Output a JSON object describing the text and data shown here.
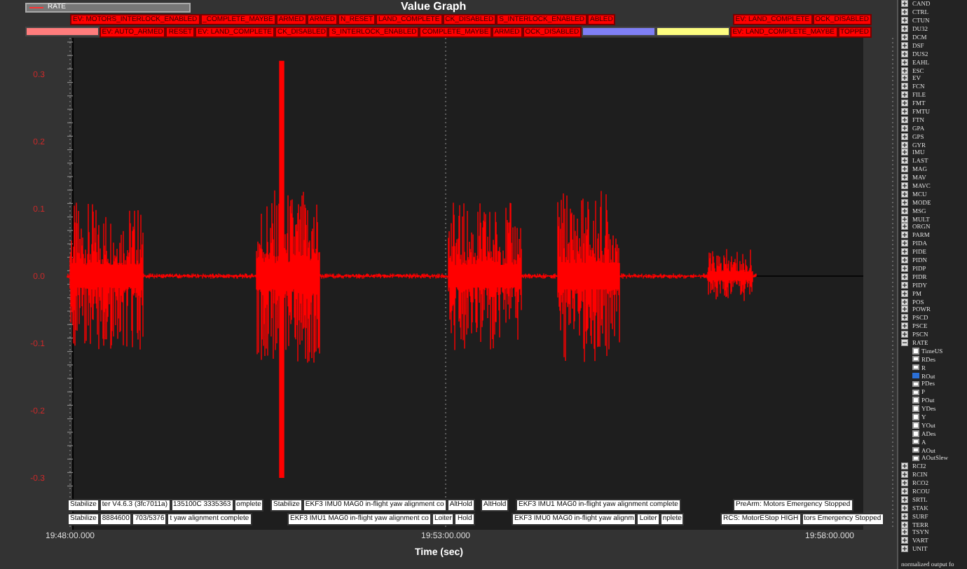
{
  "window": {
    "title": "Value Graph"
  },
  "legend": {
    "label": "RATE"
  },
  "event_rows": [
    {
      "left": [
        {
          "kind": "label",
          "text": "EV: MOTORS_INTERLOCK_ENABLED"
        },
        {
          "kind": "label",
          "text": "_COMPLETE_MAYBE"
        },
        {
          "kind": "label",
          "text": "ARMED"
        },
        {
          "kind": "label",
          "text": "ARMED"
        },
        {
          "kind": "label",
          "text": "N_RESET"
        },
        {
          "kind": "label",
          "text": "LAND_COMPLETE"
        },
        {
          "kind": "label",
          "text": "CK_DISABLED"
        },
        {
          "kind": "label",
          "text": "S_INTERLOCK_ENABLED"
        },
        {
          "kind": "label",
          "text": "ABLED"
        }
      ],
      "right": [
        {
          "kind": "label",
          "text": "EV: LAND_COMPLETE"
        },
        {
          "kind": "label",
          "text": "OCK_DISABLED"
        }
      ]
    },
    {
      "left": [
        {
          "kind": "swatch",
          "color": "#ff7c7c"
        },
        {
          "kind": "label",
          "text": "EV: AUTO_ARMED"
        },
        {
          "kind": "label",
          "text": "RESET"
        },
        {
          "kind": "label",
          "text": "EV: LAND_COMPLETE"
        },
        {
          "kind": "label",
          "text": "CK_DISABLED"
        },
        {
          "kind": "label",
          "text": "S_INTERLOCK_ENABLED"
        },
        {
          "kind": "label",
          "text": "COMPLETE_MAYBE"
        },
        {
          "kind": "label",
          "text": "ARMED"
        },
        {
          "kind": "label",
          "text": "OCK_DISABLED"
        },
        {
          "kind": "swatch",
          "color": "#7f7ff5"
        },
        {
          "kind": "swatch",
          "color": "#fdfd80"
        }
      ],
      "right": [
        {
          "kind": "label",
          "text": "EV: LAND_COMPLETE_MAYBE"
        },
        {
          "kind": "label",
          "text": "TOPPED"
        }
      ]
    }
  ],
  "y_ticks": [
    "0.3",
    "0.2",
    "0.1",
    "0.0",
    "-0.1",
    "-0.2",
    "-0.3"
  ],
  "message_rows": [
    [
      [
        "Stabilize",
        "ter V4.6.3 (3fc7011a)",
        "135100C 3335363",
        "omplete"
      ],
      [
        "Stabilize",
        "EKF3 IMU0 MAG0 in-flight yaw alignment co",
        "AltHold"
      ],
      [
        "AltHold"
      ],
      [
        "EKF3 IMU1 MAG0 in-flight yaw alignment complete"
      ],
      [
        "PreArm: Motors Emergency Stopped"
      ]
    ],
    [
      [
        "Stabilize",
        "8884600",
        "703/5376",
        "t yaw alignment complete"
      ],
      [
        "EKF3 IMU1 MAG0 in-flight yaw alignment co",
        "Loiter",
        "Hold"
      ],
      [
        "EKF3 IMU0 MAG0 in-flight yaw alignm",
        "Loiter",
        "nplete"
      ],
      [
        "RCS: MotorEStop HIGH",
        "tors Emergency Stopped"
      ]
    ]
  ],
  "x_ticks": [
    "19:48:00.000",
    "19:53:00.000",
    "19:58:00.000"
  ],
  "x_axis_title": "Time (sec)",
  "tree": [
    {
      "label": "CAND",
      "expanded": false
    },
    {
      "label": "CTRL",
      "expanded": false
    },
    {
      "label": "CTUN",
      "expanded": false
    },
    {
      "label": "DU32",
      "expanded": false
    },
    {
      "label": "DCM",
      "expanded": false
    },
    {
      "label": "DSF",
      "expanded": false
    },
    {
      "label": "DUS2",
      "expanded": false
    },
    {
      "label": "EAHL",
      "expanded": false
    },
    {
      "label": "ESC",
      "expanded": false
    },
    {
      "label": "EV",
      "expanded": false
    },
    {
      "label": "FCN",
      "expanded": false
    },
    {
      "label": "FILE",
      "expanded": false
    },
    {
      "label": "FMT",
      "expanded": false
    },
    {
      "label": "FMTU",
      "expanded": false
    },
    {
      "label": "FTN",
      "expanded": false
    },
    {
      "label": "GPA",
      "expanded": false
    },
    {
      "label": "GPS",
      "expanded": false
    },
    {
      "label": "GYR",
      "expanded": false
    },
    {
      "label": "IMU",
      "expanded": false
    },
    {
      "label": "LAST",
      "expanded": false
    },
    {
      "label": "MAG",
      "expanded": false
    },
    {
      "label": "MAV",
      "expanded": false
    },
    {
      "label": "MAVC",
      "expanded": false
    },
    {
      "label": "MCU",
      "expanded": false
    },
    {
      "label": "MODE",
      "expanded": false
    },
    {
      "label": "MSG",
      "expanded": false
    },
    {
      "label": "MULT",
      "expanded": false
    },
    {
      "label": "ORGN",
      "expanded": false
    },
    {
      "label": "PARM",
      "expanded": false
    },
    {
      "label": "PIDA",
      "expanded": false
    },
    {
      "label": "PIDE",
      "expanded": false
    },
    {
      "label": "PIDN",
      "expanded": false
    },
    {
      "label": "PIDP",
      "expanded": false
    },
    {
      "label": "PIDR",
      "expanded": false
    },
    {
      "label": "PIDY",
      "expanded": false
    },
    {
      "label": "PM",
      "expanded": false
    },
    {
      "label": "POS",
      "expanded": false
    },
    {
      "label": "POWR",
      "expanded": false
    },
    {
      "label": "PSCD",
      "expanded": false
    },
    {
      "label": "PSCE",
      "expanded": false
    },
    {
      "label": "PSCN",
      "expanded": false
    },
    {
      "label": "RATE",
      "expanded": true,
      "children": [
        {
          "label": "TimeUS",
          "checked": false
        },
        {
          "label": "RDes",
          "checked": false
        },
        {
          "label": "R",
          "checked": false
        },
        {
          "label": "ROut",
          "checked": true
        },
        {
          "label": "PDes",
          "checked": false
        },
        {
          "label": "P",
          "checked": false
        },
        {
          "label": "POut",
          "checked": false
        },
        {
          "label": "YDes",
          "checked": false
        },
        {
          "label": "Y",
          "checked": false
        },
        {
          "label": "YOut",
          "checked": false
        },
        {
          "label": "ADes",
          "checked": false
        },
        {
          "label": "A",
          "checked": false
        },
        {
          "label": "AOut",
          "checked": false
        },
        {
          "label": "AOutSlew",
          "checked": false
        }
      ]
    },
    {
      "label": "RCI2",
      "expanded": false
    },
    {
      "label": "RCIN",
      "expanded": false
    },
    {
      "label": "RCO2",
      "expanded": false
    },
    {
      "label": "RCOU",
      "expanded": false
    },
    {
      "label": "SRTL",
      "expanded": false
    },
    {
      "label": "STAK",
      "expanded": false
    },
    {
      "label": "SURF",
      "expanded": false
    },
    {
      "label": "TERR",
      "expanded": false
    },
    {
      "label": "TSYN",
      "expanded": false
    },
    {
      "label": "VART",
      "expanded": false
    },
    {
      "label": "UNIT",
      "expanded": false
    }
  ],
  "tree_footer": "normalized output fo"
}
